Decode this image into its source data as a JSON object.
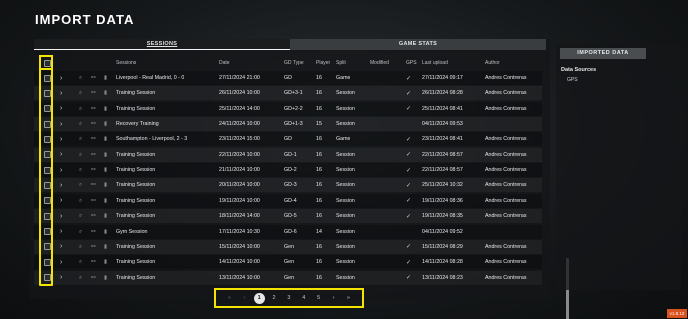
{
  "page_title": "IMPORT DATA",
  "tabs": [
    {
      "label": "SESSIONS",
      "active": true
    },
    {
      "label": "GAME STATS",
      "active": false
    }
  ],
  "columns": [
    "Sessions",
    "Date",
    "GD Type",
    "Player",
    "Split",
    "Modified",
    "GPS",
    "Last upload",
    "Author"
  ],
  "rows": [
    {
      "session": "Liverpool - Real Madrid, 0 - 0",
      "date": "27/11/2024 21:00",
      "gd": "GD",
      "player": "16",
      "split": "Game",
      "modified": "",
      "gps": "✓",
      "last_upload": "27/11/2024 09:17",
      "author": "Andres Contreras"
    },
    {
      "session": "Training Session",
      "date": "26/11/2024 10:00",
      "gd": "GD+3-1",
      "player": "16",
      "split": "Session",
      "modified": "",
      "gps": "✓",
      "last_upload": "26/11/2024 08:28",
      "author": "Andres Contreras"
    },
    {
      "session": "Training Session",
      "date": "25/11/2024 14:00",
      "gd": "GD+2-2",
      "player": "16",
      "split": "Session",
      "modified": "",
      "gps": "✓",
      "last_upload": "25/11/2024 08:41",
      "author": "Andres Contreras"
    },
    {
      "session": "Recovery Training",
      "date": "24/11/2024 10:00",
      "gd": "GD+1-3",
      "player": "15",
      "split": "Session",
      "modified": "",
      "gps": "",
      "last_upload": "04/11/2024 09:53",
      "author": ""
    },
    {
      "session": "Southampton - Liverpool, 2 - 3",
      "date": "23/11/2024 15:00",
      "gd": "GD",
      "player": "16",
      "split": "Game",
      "modified": "",
      "gps": "✓",
      "last_upload": "23/11/2024 08:41",
      "author": "Andres Contreras"
    },
    {
      "session": "Training Session",
      "date": "22/11/2024 10:00",
      "gd": "GD-1",
      "player": "16",
      "split": "Session",
      "modified": "",
      "gps": "✓",
      "last_upload": "22/11/2024 08:57",
      "author": "Andres Contreras"
    },
    {
      "session": "Training Session",
      "date": "21/11/2024 10:00",
      "gd": "GD-2",
      "player": "16",
      "split": "Session",
      "modified": "",
      "gps": "✓",
      "last_upload": "22/11/2024 08:57",
      "author": "Andres Contreras"
    },
    {
      "session": "Training Session",
      "date": "20/11/2024 10:00",
      "gd": "GD-3",
      "player": "16",
      "split": "Session",
      "modified": "",
      "gps": "✓",
      "last_upload": "25/11/2024 10:32",
      "author": "Andres Contreras"
    },
    {
      "session": "Training Session",
      "date": "19/11/2024 10:00",
      "gd": "GD-4",
      "player": "16",
      "split": "Session",
      "modified": "",
      "gps": "✓",
      "last_upload": "19/11/2024 08:36",
      "author": "Andres Contreras"
    },
    {
      "session": "Training Session",
      "date": "18/11/2024 14:00",
      "gd": "GD-5",
      "player": "16",
      "split": "Session",
      "modified": "",
      "gps": "✓",
      "last_upload": "19/11/2024 08:35",
      "author": "Andres Contreras"
    },
    {
      "session": "Gym Session",
      "date": "17/11/2024 10:30",
      "gd": "GD-6",
      "player": "14",
      "split": "Session",
      "modified": "",
      "gps": "",
      "last_upload": "04/11/2024 09:52",
      "author": ""
    },
    {
      "session": "Training Session",
      "date": "15/11/2024 10:00",
      "gd": "Gen",
      "player": "16",
      "split": "Session",
      "modified": "",
      "gps": "✓",
      "last_upload": "15/11/2024 08:29",
      "author": "Andres Contreras"
    },
    {
      "session": "Training Session",
      "date": "14/11/2024 10:00",
      "gd": "Gen",
      "player": "16",
      "split": "Session",
      "modified": "",
      "gps": "✓",
      "last_upload": "14/11/2024 08:28",
      "author": "Andres Contreras"
    },
    {
      "session": "Training Session",
      "date": "13/11/2024 10:00",
      "gd": "Gen",
      "player": "16",
      "split": "Session",
      "modified": "",
      "gps": "✓",
      "last_upload": "13/11/2024 08:23",
      "author": "Andres Contreras"
    }
  ],
  "pagination": {
    "first": "«",
    "prev": "‹",
    "pages": [
      "1",
      "2",
      "3",
      "4",
      "5"
    ],
    "current": "1",
    "next": "›",
    "last": "»"
  },
  "side_panel": {
    "header": "IMPORTED DATA",
    "subheader": "Data Sources",
    "items": [
      "GPS"
    ]
  },
  "version": "v1.8.12",
  "icons": {
    "row_chevron": "chevron-right-icon",
    "row_search": "search-icon",
    "row_link": "link-icon",
    "row_delete": "trash-icon"
  },
  "colors": {
    "highlight": "#f3e400",
    "version_badge": "#d9531e"
  }
}
